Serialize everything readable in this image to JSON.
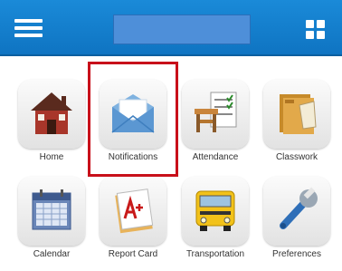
{
  "header": {
    "menu_icon": "hamburger-menu-icon",
    "apps_icon": "grid-apps-icon",
    "brand_color": "#1282d0"
  },
  "tiles": [
    {
      "label": "Home",
      "icon": "house-icon"
    },
    {
      "label": "Notifications",
      "icon": "envelope-icon"
    },
    {
      "label": "Attendance",
      "icon": "desk-checklist-icon"
    },
    {
      "label": "Classwork",
      "icon": "folder-icon"
    },
    {
      "label": "Calendar",
      "icon": "calendar-icon"
    },
    {
      "label": "Report Card",
      "icon": "report-card-icon"
    },
    {
      "label": "Transportation",
      "icon": "school-bus-icon"
    },
    {
      "label": "Preferences",
      "icon": "wrench-icon"
    }
  ],
  "selected_tile": "Notifications",
  "highlight_color": "#c8101a"
}
